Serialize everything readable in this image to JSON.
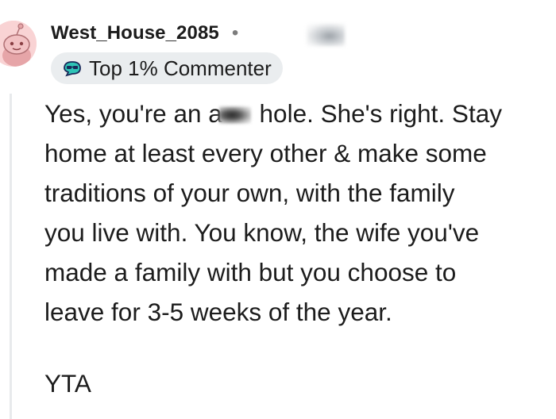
{
  "comment": {
    "author": "West_House_2085",
    "separator": "•",
    "badge_label": "Top 1% Commenter",
    "body_lines": [
      {
        "before": "Yes, you're an a",
        "after": "hole. She's right. Stay"
      },
      "home at least every other & make some",
      "traditions of your own, with the family",
      "you live with. You know, the wife you've",
      "made a family with but you choose to",
      "leave for 3-5 weeks of the year."
    ],
    "verdict": "YTA"
  },
  "icons": {
    "avatar": "snoo-avatar-icon",
    "badge": "top-commenter-badge-icon"
  },
  "colors": {
    "text": "#1c1c1c",
    "badge_bg": "#eaedef",
    "avatar_bg": "#f9d3d4",
    "thread_line": "#e8eaec"
  }
}
